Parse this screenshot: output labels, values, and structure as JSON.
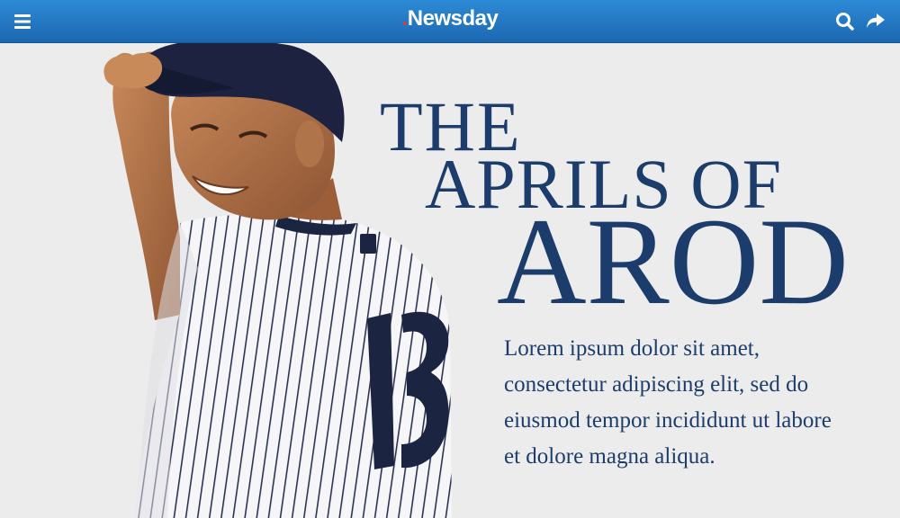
{
  "header": {
    "brand_dot": ".",
    "brand_name": "Newsday",
    "menu_icon": "hamburger-menu-icon",
    "search_icon": "search-icon",
    "share_icon": "share-arrow-icon",
    "bar_color": "#1f72bf"
  },
  "article": {
    "headline_line1": "THE",
    "headline_line2": "APRILS OF",
    "headline_line3": "AROD",
    "body": "Lorem ipsum dolor sit amet, consectetur adipiscing elit, sed do eiusmod tempor incididunt ut labore et dolore magna aliqua.",
    "headline_color": "#1c3d6c",
    "background_color": "#ececec"
  },
  "photo": {
    "subject": "baseball-player-photo",
    "jersey_number": "13"
  }
}
